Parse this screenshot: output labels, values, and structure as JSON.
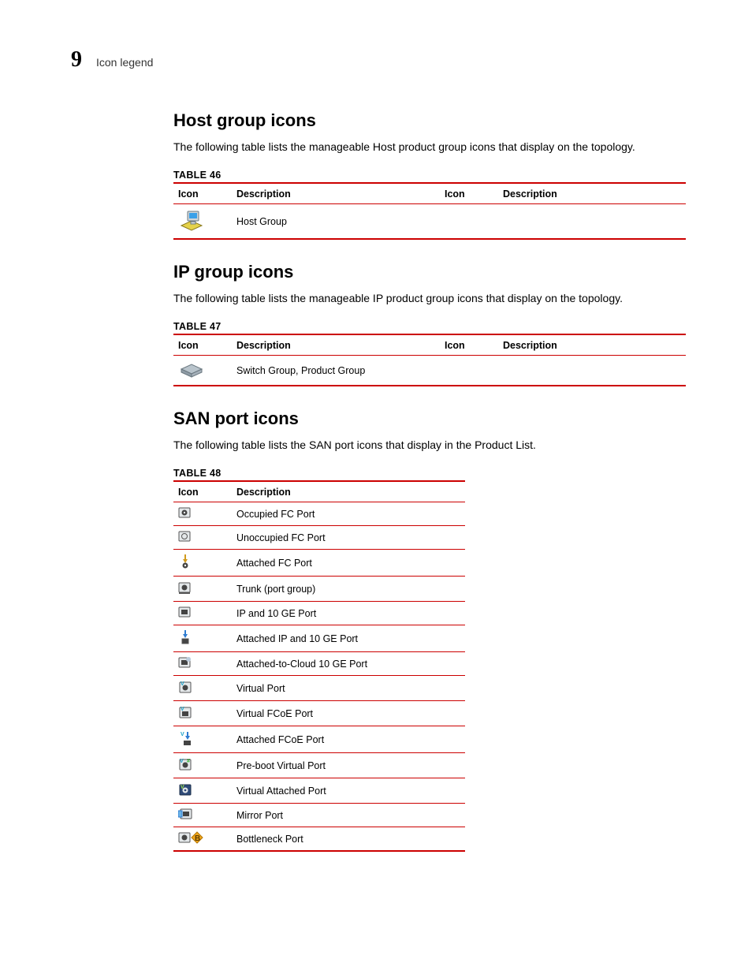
{
  "header": {
    "chapter_number": "9",
    "running_title": "Icon legend"
  },
  "sections": {
    "host": {
      "title": "Host group icons",
      "intro": "The following table lists the manageable Host product group icons that display on the topology.",
      "table_caption": "TABLE 46",
      "head": {
        "c1": "Icon",
        "c2": "Description",
        "c3": "Icon",
        "c4": "Description"
      },
      "rows": [
        {
          "icon": "host-group-icon",
          "desc": "Host Group"
        }
      ]
    },
    "ip": {
      "title": "IP group icons",
      "intro": "The following table lists the manageable IP product group icons that display on the topology.",
      "table_caption": "TABLE 47",
      "head": {
        "c1": "Icon",
        "c2": "Description",
        "c3": "Icon",
        "c4": "Description"
      },
      "rows": [
        {
          "icon": "switch-group-icon",
          "desc": "Switch Group, Product Group"
        }
      ]
    },
    "san": {
      "title": "SAN port icons",
      "intro": "The following table lists the SAN port icons that display in the Product List.",
      "table_caption": "TABLE 48",
      "head": {
        "c1": "Icon",
        "c2": "Description"
      },
      "rows": [
        {
          "icon": "occupied-fc-port-icon",
          "desc": "Occupied FC Port"
        },
        {
          "icon": "unoccupied-fc-port-icon",
          "desc": "Unoccupied FC Port"
        },
        {
          "icon": "attached-fc-port-icon",
          "desc": "Attached FC Port"
        },
        {
          "icon": "trunk-port-group-icon",
          "desc": "Trunk (port group)"
        },
        {
          "icon": "ip-10ge-port-icon",
          "desc": "IP and 10 GE Port"
        },
        {
          "icon": "attached-ip-10ge-port-icon",
          "desc": "Attached IP and 10 GE Port"
        },
        {
          "icon": "attached-cloud-10ge-port-icon",
          "desc": "Attached-to-Cloud 10 GE Port"
        },
        {
          "icon": "virtual-port-icon",
          "desc": "Virtual Port"
        },
        {
          "icon": "virtual-fcoe-port-icon",
          "desc": "Virtual FCoE Port"
        },
        {
          "icon": "attached-fcoe-port-icon",
          "desc": "Attached FCoE Port"
        },
        {
          "icon": "preboot-virtual-port-icon",
          "desc": "Pre-boot Virtual Port"
        },
        {
          "icon": "virtual-attached-port-icon",
          "desc": "Virtual Attached Port"
        },
        {
          "icon": "mirror-port-icon",
          "desc": "Mirror Port"
        },
        {
          "icon": "bottleneck-port-icon",
          "desc": "Bottleneck Port"
        }
      ]
    }
  }
}
